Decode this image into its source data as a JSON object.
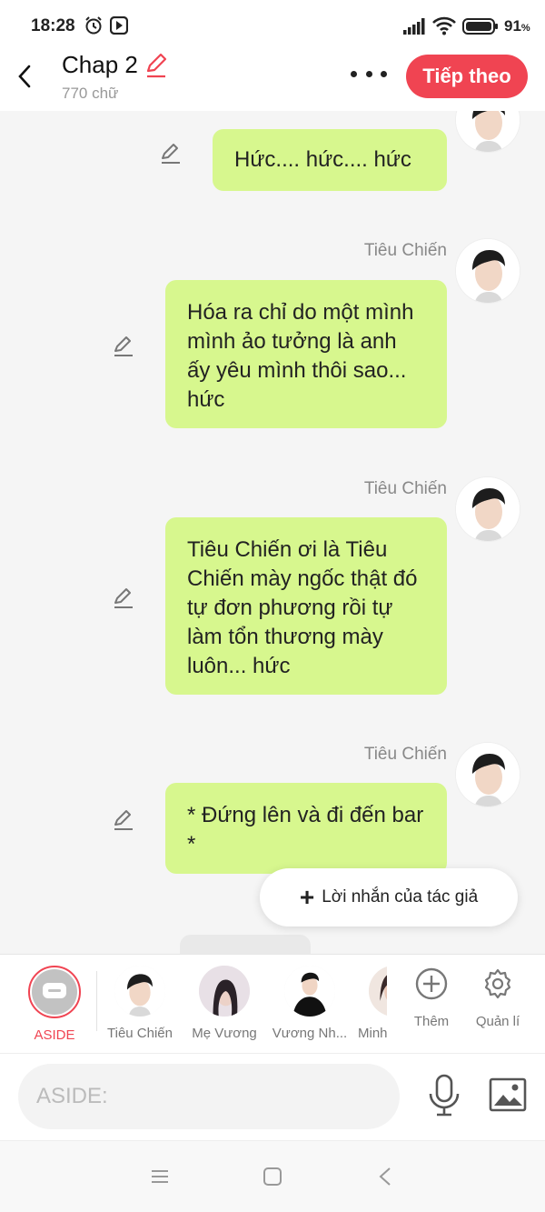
{
  "status_bar": {
    "time": "18:28",
    "battery": "91",
    "battery_unit": "%"
  },
  "header": {
    "title": "Chap 2",
    "word_count": "770 chữ",
    "next_label": "Tiếp theo"
  },
  "messages": [
    {
      "sender": "",
      "text": "Hức.... hức.... hức"
    },
    {
      "sender": "Tiêu Chiến",
      "text": "Hóa ra chỉ do một mình mình ảo tưởng là anh ấy yêu mình thôi sao... hức"
    },
    {
      "sender": "Tiêu Chiến",
      "text": "Tiêu Chiến ơi là Tiêu Chiến mày ngốc thật đó tự đơn phương rồi tự làm tổn thương mày luôn... hức"
    },
    {
      "sender": "Tiêu Chiến",
      "text": "* Đứng lên và đi đến bar *"
    }
  ],
  "author_note": {
    "label": "Lời nhắn của tác giả"
  },
  "characters": [
    {
      "label": "ASIDE"
    },
    {
      "label": "Tiêu Chiến"
    },
    {
      "label": "Mẹ Vương"
    },
    {
      "label": "Vương Nh..."
    },
    {
      "label": "Minh"
    }
  ],
  "tools": {
    "add_label": "Thêm",
    "manage_label": "Quản lí"
  },
  "input": {
    "placeholder": "ASIDE:"
  },
  "colors": {
    "accent": "#f04452",
    "bubble": "#d7f78e"
  }
}
